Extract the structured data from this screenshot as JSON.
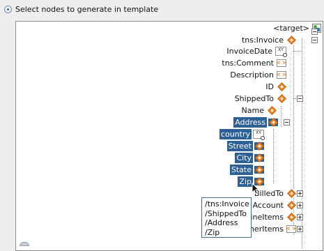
{
  "option": {
    "label": "Select nodes to generate in template",
    "selected": true
  },
  "tree": {
    "target": "<target>",
    "nodes": {
      "invoice": "tns:Invoice",
      "invoice_date": "InvoiceDate",
      "comment": "tns:Comment",
      "description": "Description",
      "id": "ID",
      "shipped_to": "ShippedTo",
      "name": "Name",
      "address": "Address",
      "country": "country",
      "street": "Street",
      "city": "City",
      "state": "State",
      "zip": "Zip",
      "billed_to": "BilledTo",
      "account": "Account",
      "line_items": "LineItems",
      "other_items": "OtherItems"
    },
    "icon_xy_text": "XY",
    "icon_brackets_text": "< >"
  },
  "tooltip": {
    "lines": [
      "/tns:Invoice",
      "/ShippedTo",
      "/Address",
      "/Zip"
    ]
  },
  "colors": {
    "selection": "#2d6094",
    "element_icon": "#f08a2a",
    "panel_border": "#8a8a8a"
  }
}
